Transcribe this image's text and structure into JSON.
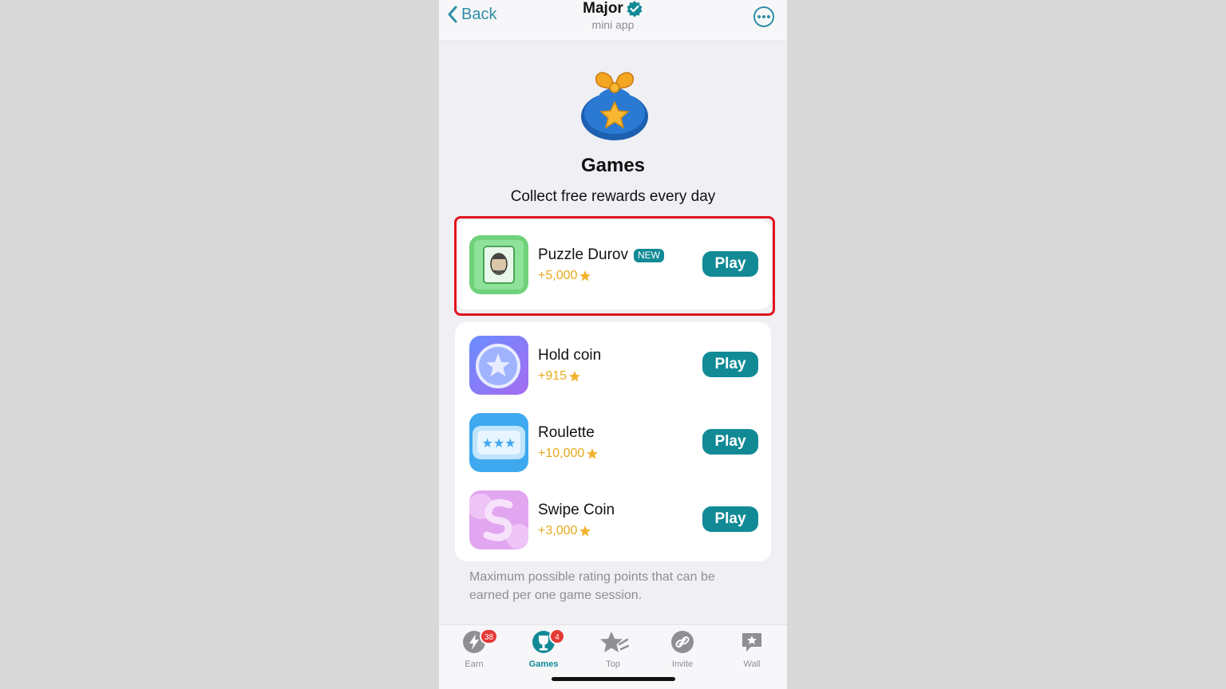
{
  "header": {
    "back_label": "Back",
    "title": "Major",
    "subtitle": "mini app"
  },
  "hero": {
    "title": "Games",
    "subtitle": "Collect free rewards every day"
  },
  "games": [
    {
      "name": "Puzzle Durov",
      "badge": "NEW",
      "reward": "+5,000",
      "play_label": "Play",
      "highlighted": true
    },
    {
      "name": "Hold coin",
      "reward": "+915",
      "play_label": "Play"
    },
    {
      "name": "Roulette",
      "reward": "+10,000",
      "play_label": "Play"
    },
    {
      "name": "Swipe Coin",
      "reward": "+3,000",
      "play_label": "Play"
    }
  ],
  "footnote": "Maximum possible rating points that can be earned per one game session.",
  "tabs": [
    {
      "label": "Earn",
      "badge": "38",
      "active": false,
      "icon": "lightning-icon"
    },
    {
      "label": "Games",
      "badge": "4",
      "active": true,
      "icon": "trophy-icon"
    },
    {
      "label": "Top",
      "active": false,
      "icon": "star-icon"
    },
    {
      "label": "Invite",
      "active": false,
      "icon": "link-icon"
    },
    {
      "label": "Wall",
      "active": false,
      "icon": "chat-star-icon"
    }
  ],
  "colors": {
    "accent": "#128a96",
    "reward": "#e6a91c",
    "highlight": "#e0141e",
    "badge": "#e53935"
  }
}
